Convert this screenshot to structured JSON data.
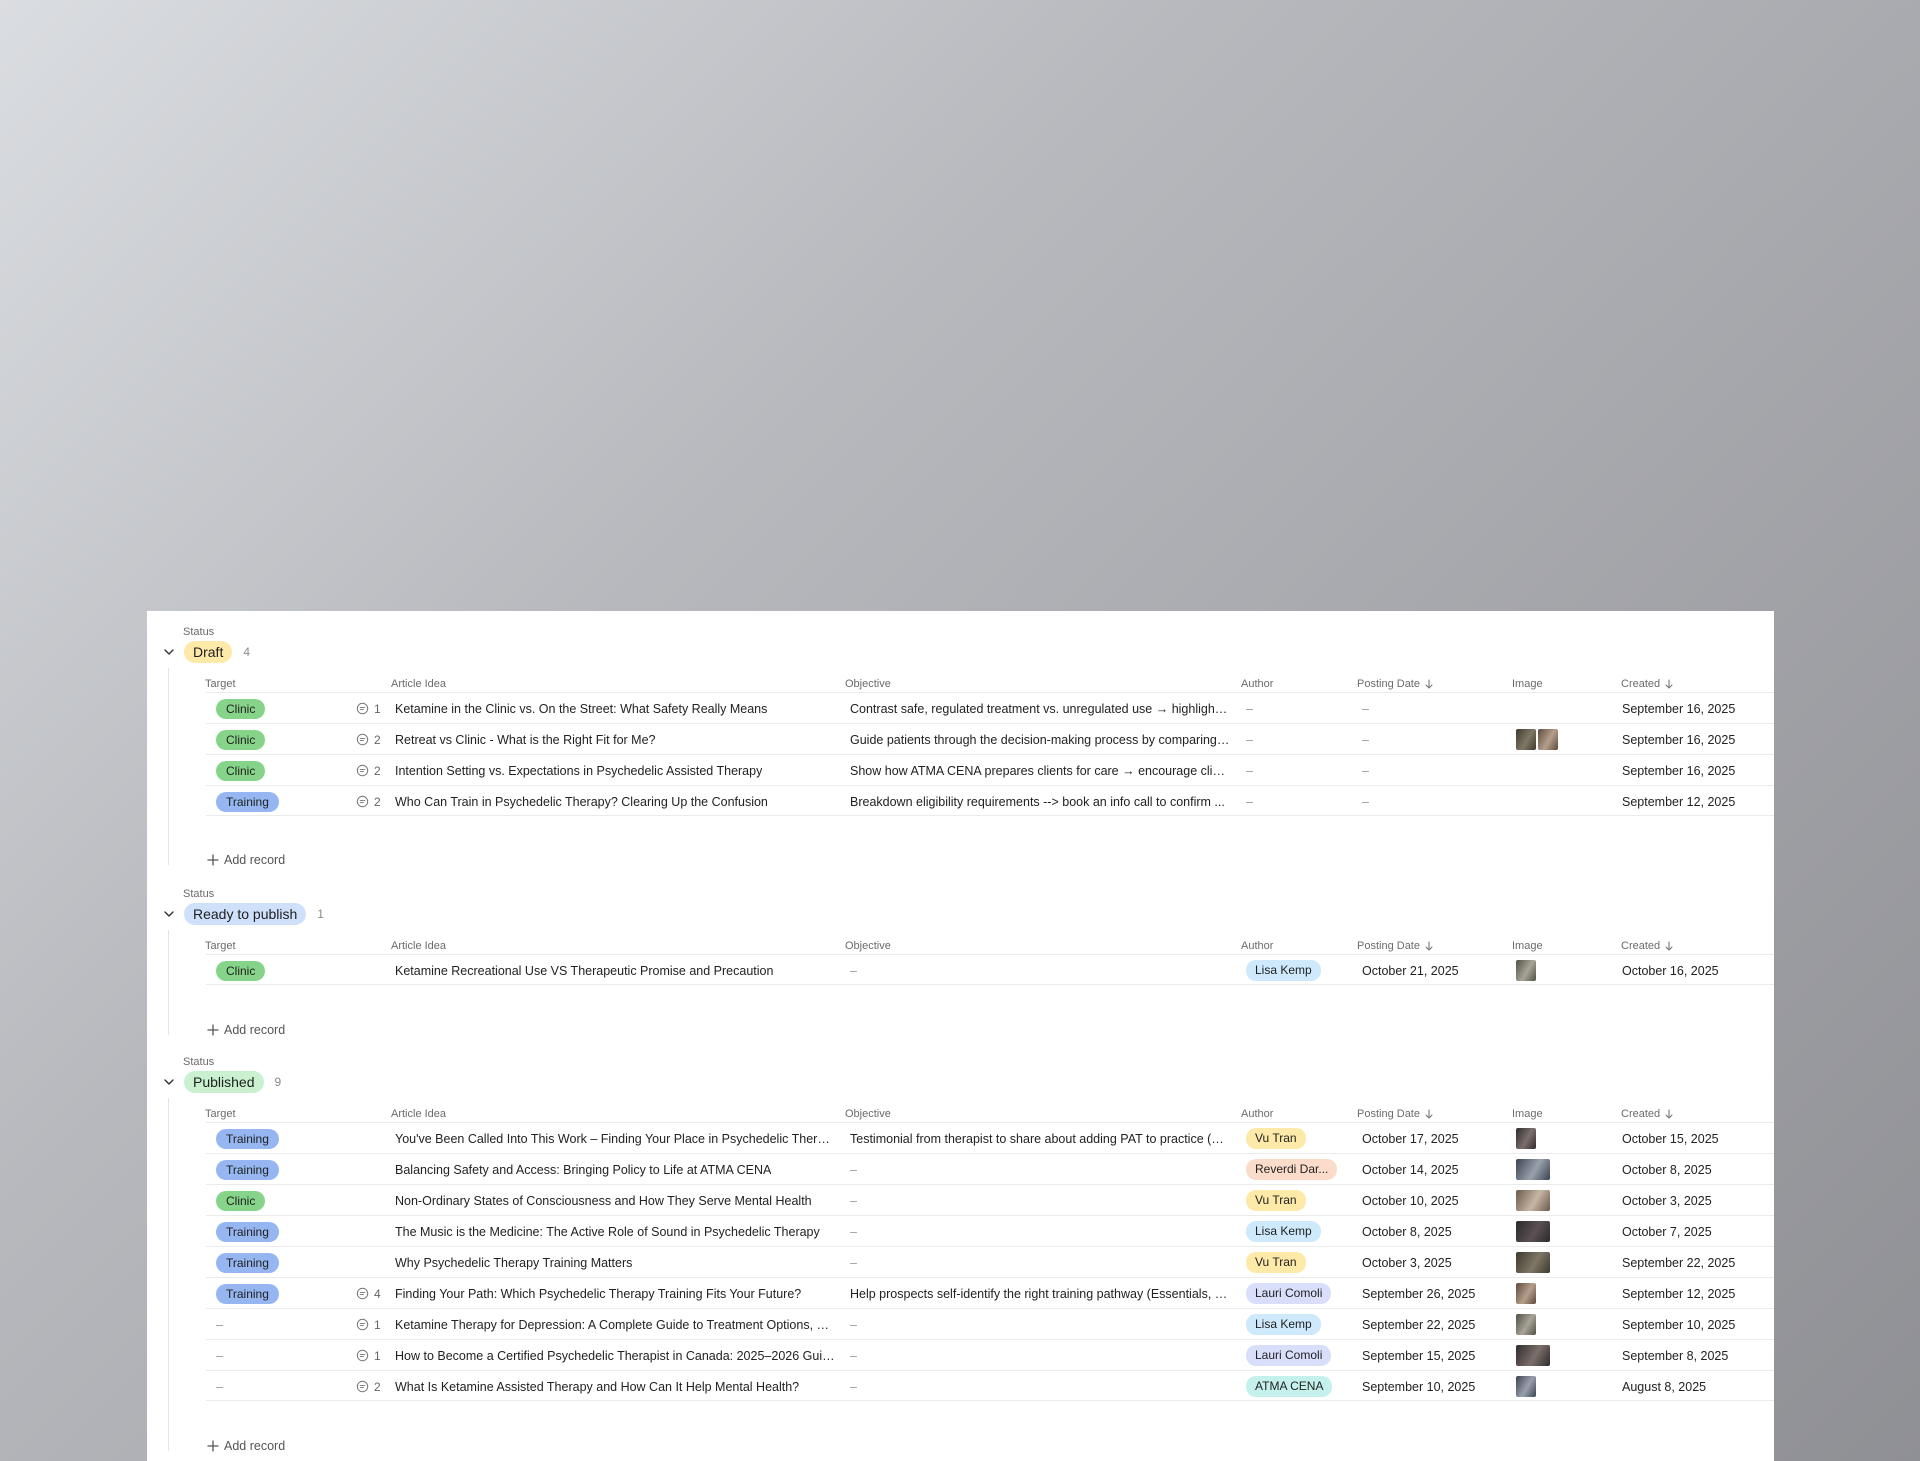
{
  "status_caption": "Status",
  "add_record_label": "Add record",
  "columns": {
    "target": "Target",
    "article_idea": "Article Idea",
    "objective": "Objective",
    "author": "Author",
    "posting_date": "Posting Date",
    "image": "Image",
    "created": "Created"
  },
  "colors": {
    "draft": "#fde9a8",
    "ready": "#cfe0fb",
    "published": "#c9f0cf",
    "clinic": "#86d48a",
    "training": "#95b6f0",
    "author_yellow": "#fde9a8",
    "author_blue": "#cde9fb",
    "author_peach": "#fbdccb",
    "author_lavender": "#d9dffb",
    "author_teal": "#c5f1ec"
  },
  "groups": [
    {
      "id": "draft",
      "label": "Draft",
      "count": "4",
      "rows": [
        {
          "target": "Clinic",
          "comments": "1",
          "idea": "Ketamine in the Clinic vs. On the Street: What Safety Really Means",
          "objective": "Contrast safe, regulated treatment vs. unregulated use → highlight ...",
          "author": "–",
          "posting": "–",
          "image": "",
          "created": "September 16, 2025"
        },
        {
          "target": "Clinic",
          "comments": "2",
          "idea": "Retreat vs Clinic - What is the Right Fit for Me?",
          "objective": "Guide patients through the decision-making process by comparing ...",
          "author": "–",
          "posting": "–",
          "image": "pair",
          "created": "September 16, 2025"
        },
        {
          "target": "Clinic",
          "comments": "2",
          "idea": "Intention Setting vs. Expectations in Psychedelic Assisted Therapy",
          "objective": "Show how ATMA CENA prepares clients for care → encourage clinic ...",
          "author": "–",
          "posting": "–",
          "image": "",
          "created": "September 16, 2025"
        },
        {
          "target": "Training",
          "comments": "2",
          "idea": "Who Can Train in Psychedelic Therapy? Clearing Up the Confusion",
          "objective": "Breakdown eligibility requirements --> book an info call to confirm ...",
          "author": "–",
          "posting": "–",
          "image": "",
          "created": "September 12, 2025"
        }
      ]
    },
    {
      "id": "ready",
      "label": "Ready to publish",
      "count": "1",
      "rows": [
        {
          "target": "Clinic",
          "comments": "",
          "idea": "Ketamine Recreational Use VS Therapeutic Promise and Precaution",
          "objective": "–",
          "author": "Lisa Kemp",
          "author_color": "author_blue",
          "posting": "October 21, 2025",
          "image": "single",
          "created": "October 16, 2025"
        }
      ]
    },
    {
      "id": "published",
      "label": "Published",
      "count": "9",
      "rows": [
        {
          "target": "Training",
          "comments": "",
          "idea": "You've Been Called Into This Work – Finding Your Place in Psychedelic Therapy",
          "objective": "Testimonial from therapist to share about adding PAT to practice (La...",
          "author": "Vu Tran",
          "author_color": "author_yellow",
          "posting": "October 17, 2025",
          "image": "single",
          "created": "October 15, 2025"
        },
        {
          "target": "Training",
          "comments": "",
          "idea": "Balancing Safety and Access: Bringing Policy to Life at ATMA CENA",
          "objective": "–",
          "author": "Reverdi Dar...",
          "author_color": "author_peach",
          "posting": "October 14, 2025",
          "image": "wide",
          "created": "October 8, 2025"
        },
        {
          "target": "Clinic",
          "comments": "",
          "idea": "Non-Ordinary States of Consciousness and How They Serve Mental Health",
          "objective": "–",
          "author": "Vu Tran",
          "author_color": "author_yellow",
          "posting": "October 10, 2025",
          "image": "wide",
          "created": "October 3, 2025"
        },
        {
          "target": "Training",
          "comments": "",
          "idea": "The Music is the Medicine: The Active Role of Sound in Psychedelic Therapy",
          "objective": "–",
          "author": "Lisa Kemp",
          "author_color": "author_blue",
          "posting": "October 8, 2025",
          "image": "wide",
          "created": "October 7, 2025"
        },
        {
          "target": "Training",
          "comments": "",
          "idea": "Why Psychedelic Therapy Training Matters",
          "objective": "–",
          "author": "Vu Tran",
          "author_color": "author_yellow",
          "posting": "October 3, 2025",
          "image": "wide",
          "created": "September 22, 2025"
        },
        {
          "target": "Training",
          "comments": "4",
          "idea": "Finding Your Path: Which Psychedelic Therapy Training Fits Your Future?",
          "objective": "Help prospects self-identify the right training pathway (Essentials, Cl...",
          "author": "Lauri Comoli",
          "author_color": "author_lavender",
          "posting": "September 26, 2025",
          "image": "single",
          "created": "September 12, 2025"
        },
        {
          "target": "–",
          "comments": "1",
          "idea": "Ketamine Therapy for Depression: A Complete Guide to Treatment Options, Sa...",
          "objective": "–",
          "author": "Lisa Kemp",
          "author_color": "author_blue",
          "posting": "September 22, 2025",
          "image": "single",
          "created": "September 10, 2025"
        },
        {
          "target": "–",
          "comments": "1",
          "idea": "How to Become a Certified Psychedelic Therapist in Canada: 2025–2026 Guide",
          "objective": "–",
          "author": "Lauri Comoli",
          "author_color": "author_lavender",
          "posting": "September 15, 2025",
          "image": "wide",
          "created": "September 8, 2025"
        },
        {
          "target": "–",
          "comments": "2",
          "idea": "What Is Ketamine Assisted Therapy and How Can It Help Mental Health?",
          "objective": "–",
          "author": "ATMA CENA",
          "author_color": "author_teal",
          "posting": "September 10, 2025",
          "image": "single",
          "created": "August 8, 2025"
        }
      ]
    }
  ]
}
